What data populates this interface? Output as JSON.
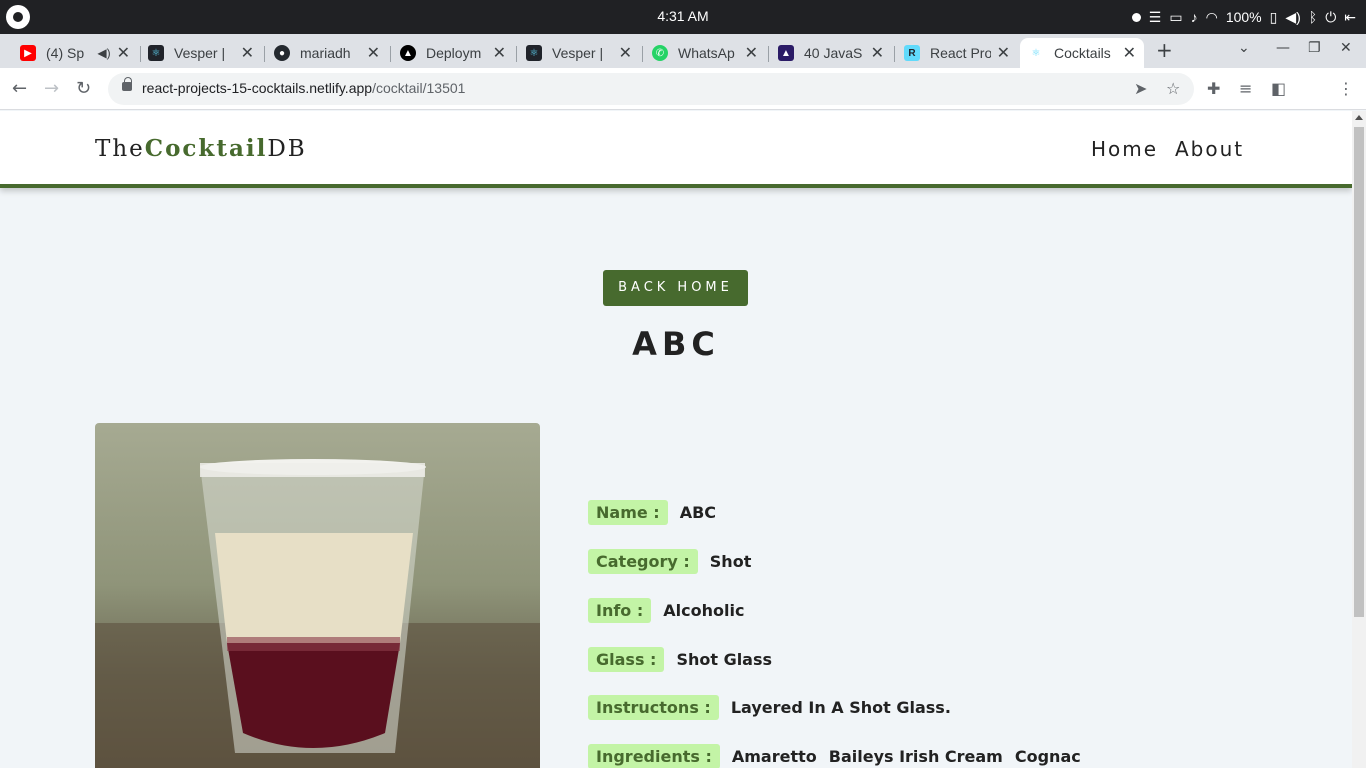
{
  "os": {
    "clock": "4:31 AM",
    "battery": "100%"
  },
  "tabs": [
    {
      "title": "(4) Sp",
      "icon": "youtube-icon",
      "color": "#ff0000"
    },
    {
      "title": "Vesper |",
      "icon": "react-icon",
      "color": "#61dafb"
    },
    {
      "title": "mariadh",
      "icon": "github-icon",
      "color": "#24292f"
    },
    {
      "title": "Deploym",
      "icon": "vercel-icon",
      "color": "#000000"
    },
    {
      "title": "Vesper |",
      "icon": "react-icon",
      "color": "#61dafb"
    },
    {
      "title": "WhatsAp",
      "icon": "whatsapp-icon",
      "color": "#25d366"
    },
    {
      "title": "40 JavaS",
      "icon": "course-icon",
      "color": "#2b1b66"
    },
    {
      "title": "React Pro",
      "icon": "react-projects-icon",
      "color": "#61dafb"
    },
    {
      "title": "Cocktails",
      "icon": "react-icon",
      "color": "#61dafb",
      "active": true
    }
  ],
  "address": {
    "domain": "react-projects-15-cocktails.netlify.app",
    "path": "/cocktail/13501"
  },
  "site": {
    "logo_prefix": "The",
    "logo_brand": "Cocktail",
    "logo_suffix": "DB",
    "nav_home": "Home",
    "nav_about": "About",
    "back_label": "BACK HOME",
    "accent": "#476a2e",
    "label_bg": "#c3f4a6"
  },
  "drink": {
    "title": "ABC",
    "name_label": "Name :",
    "name": "ABC",
    "category_label": "Category :",
    "category": "Shot",
    "info_label": "Info :",
    "info": "Alcoholic",
    "glass_label": "Glass :",
    "glass": "Shot Glass",
    "instructions_label": "Instructons :",
    "instructions": "Layered In A Shot Glass.",
    "ingredients_label": "Ingredients :",
    "ingredients": [
      "Amaretto",
      "Baileys Irish Cream",
      "Cognac"
    ]
  }
}
